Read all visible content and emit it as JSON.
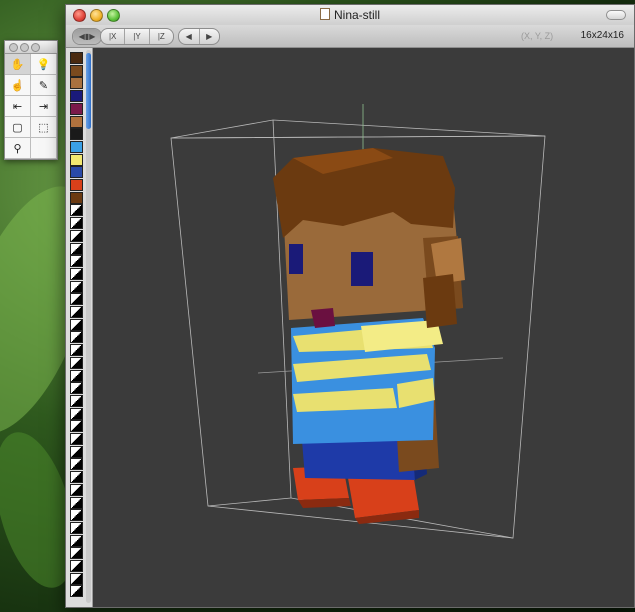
{
  "window": {
    "title": "Nina-still",
    "coordinate_readout": "(X, Y, Z)",
    "dimensions": "16x24x16"
  },
  "toolbar": {
    "view_buttons": [
      "|X",
      "|Y",
      "|Z"
    ],
    "nav_buttons": [
      "◀",
      "▶"
    ]
  },
  "tool_palette": {
    "tools": [
      "hand-icon",
      "bulb-icon",
      "finger-icon",
      "pencil-icon",
      "move-left-icon",
      "move-right-icon",
      "select-box-icon",
      "select-dotted-icon",
      "eyedropper-icon"
    ]
  },
  "color_palette": {
    "swatches": [
      "#4a2a10",
      "#7a4a1e",
      "#a9713f",
      "#1a1a7a",
      "#7a1a4a",
      "#b0723e",
      "#1a1a1a",
      "#3aa0e6",
      "#f2e870",
      "#2a4aa8",
      "#d8401a",
      "#6b3a12"
    ],
    "empty_swatch_count": 33
  },
  "colors": {
    "hair": "#6b3a10",
    "skin": "#9a6a3a",
    "eyes": "#1a1a78",
    "mouth": "#6a1040",
    "shirt_yellow": "#e8e070",
    "shirt_blue": "#3a90e0",
    "pants": "#1e3aa8",
    "shoes": "#d8401a"
  }
}
